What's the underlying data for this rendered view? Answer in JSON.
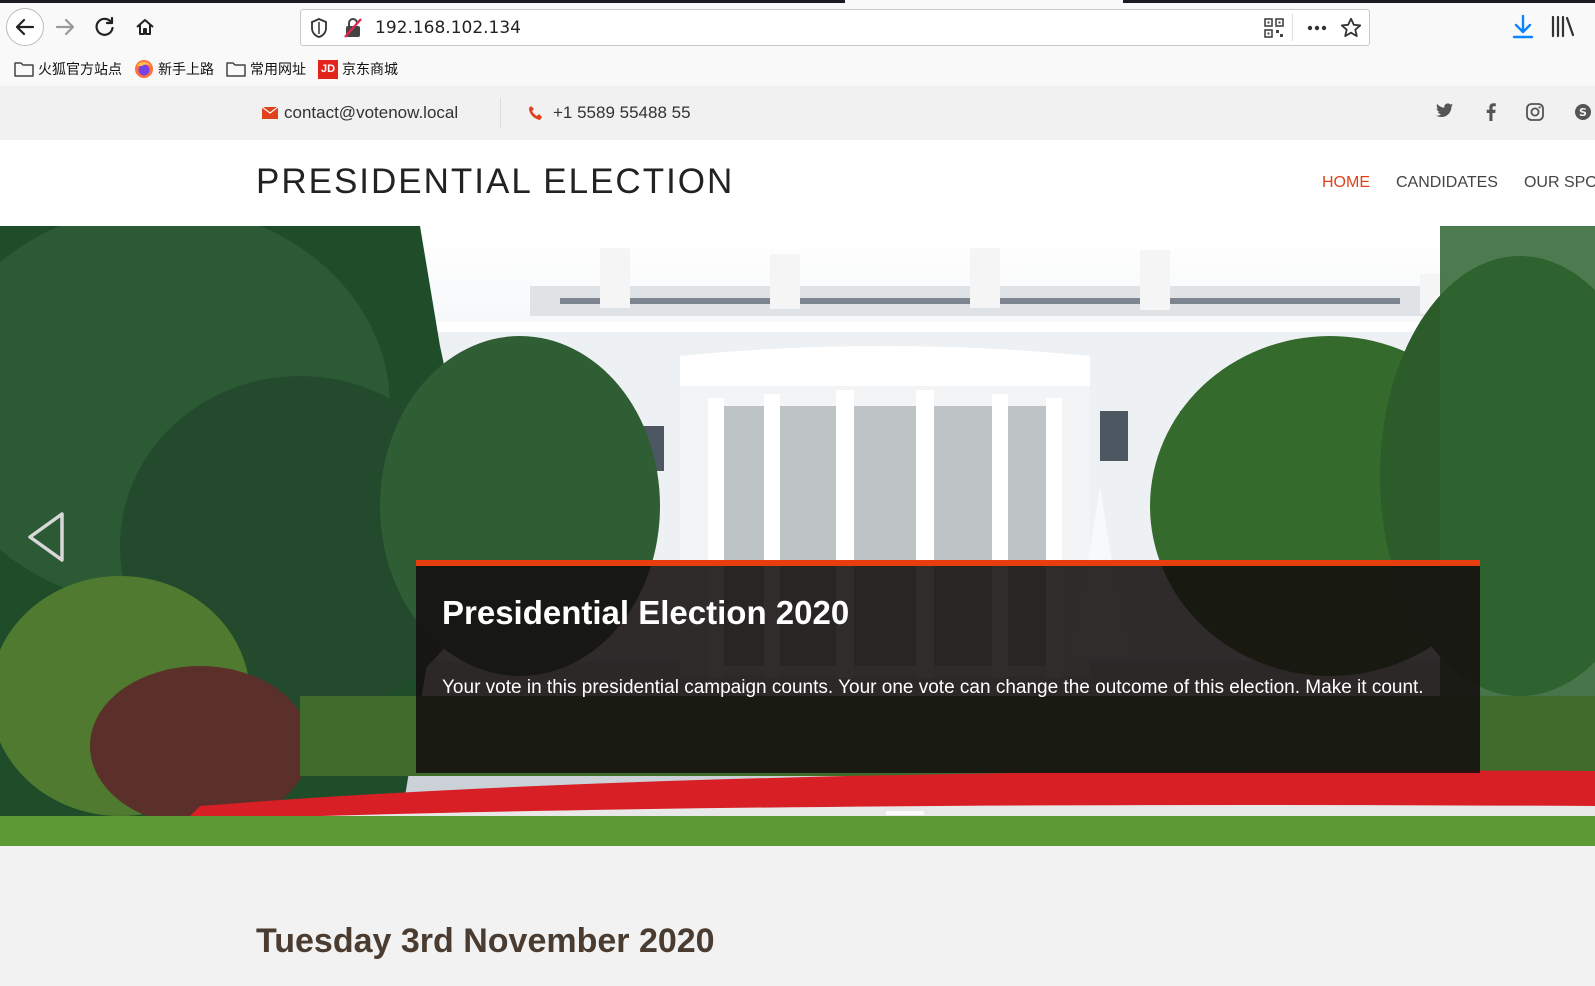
{
  "browser": {
    "url": "192.168.102.134",
    "bookmarks": [
      {
        "label": "火狐官方站点",
        "icon": "folder-icon"
      },
      {
        "label": "新手上路",
        "icon": "firefox-icon"
      },
      {
        "label": "常用网址",
        "icon": "folder-icon"
      },
      {
        "label": "京东商城",
        "icon": "jd-icon",
        "badge": "JD"
      }
    ]
  },
  "topbar": {
    "email": "contact@votenow.local",
    "phone": "+1 5589 55488 55"
  },
  "header": {
    "logo": "PRESIDENTIAL ELECTION",
    "nav": {
      "home": "HOME",
      "candidates": "CANDIDATES",
      "sponsors": "OUR SPONSORS"
    }
  },
  "hero": {
    "title": "Presidential Election 2020",
    "text": "Your vote in this presidential campaign counts. Your one vote can change the outcome of this election. Make it count."
  },
  "main": {
    "date_heading": "Tuesday 3rd November 2020"
  },
  "colors": {
    "accent": "#e83e0b",
    "nav_active": "#e0421c"
  }
}
